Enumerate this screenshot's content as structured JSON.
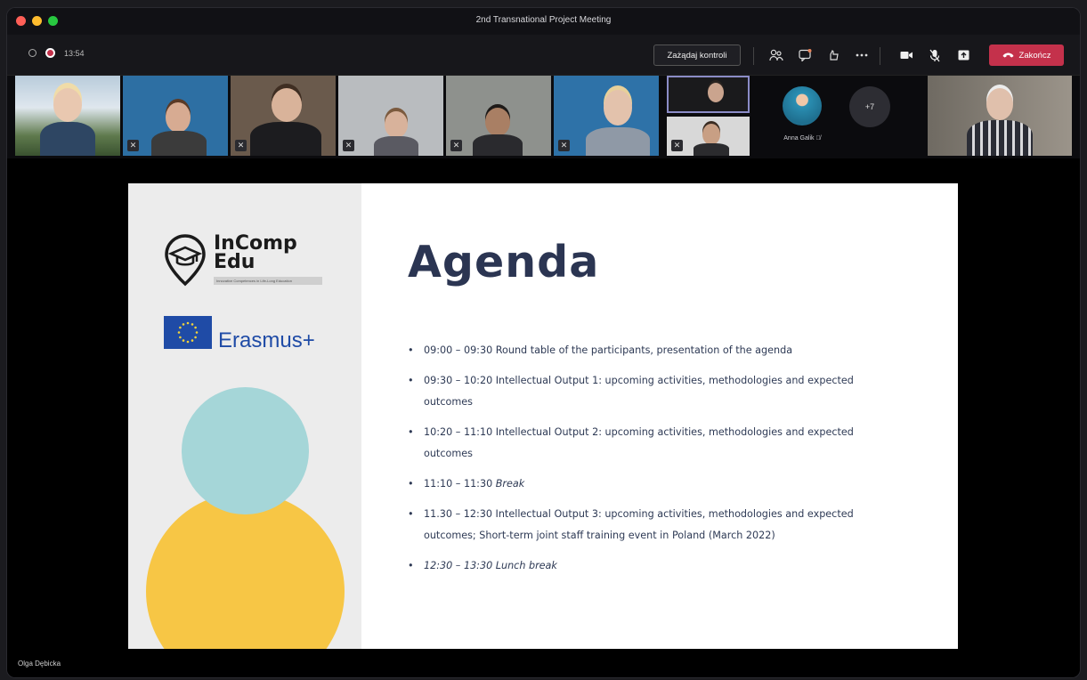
{
  "window": {
    "title": "2nd Transnational Project Meeting"
  },
  "toolbar": {
    "timer": "13:54",
    "request_control_label": "Zażądaj kontroli",
    "leave_label": "Zakończ",
    "icons": [
      "people-icon",
      "chat-icon",
      "reactions-icon",
      "more-icon",
      "camera-icon",
      "mic-muted-icon",
      "share-icon"
    ]
  },
  "participants": {
    "named_tile": "Anna Galik",
    "overflow_count": "+7"
  },
  "slide": {
    "logo_line1": "InComp",
    "logo_line2": "Edu",
    "logo_tagline": "Innovative Competences in Life-Long Education",
    "erasmus_label": "Erasmus+",
    "title": "Agenda",
    "items": [
      {
        "time": "09:00 – 09:30",
        "text": "Round table of the participants, presentation of the agenda"
      },
      {
        "time": "09:30 – 10:20",
        "text": "Intellectual Output 1: upcoming activities, methodologies and expected outcomes"
      },
      {
        "time": "10:20 – 11:10",
        "text": "Intellectual Output 2: upcoming activities, methodologies and expected outcomes"
      },
      {
        "time": "11:10 – 11:30",
        "text": "Break"
      },
      {
        "time": "11.30 – 12:30",
        "text": "Intellectual Output 3: upcoming activities, methodologies and expected outcomes; Short-term joint staff training event in Poland (March 2022)"
      },
      {
        "time": "12:30 – 13:30",
        "text": "Lunch break"
      }
    ]
  },
  "presenter_name": "Olga Dębicka",
  "colors": {
    "end_call": "#c4314b",
    "agenda_text": "#2b3552",
    "erasmus_blue": "#1f4ba6",
    "circle_teal": "#a5d6d8",
    "circle_yellow": "#f7c645"
  }
}
